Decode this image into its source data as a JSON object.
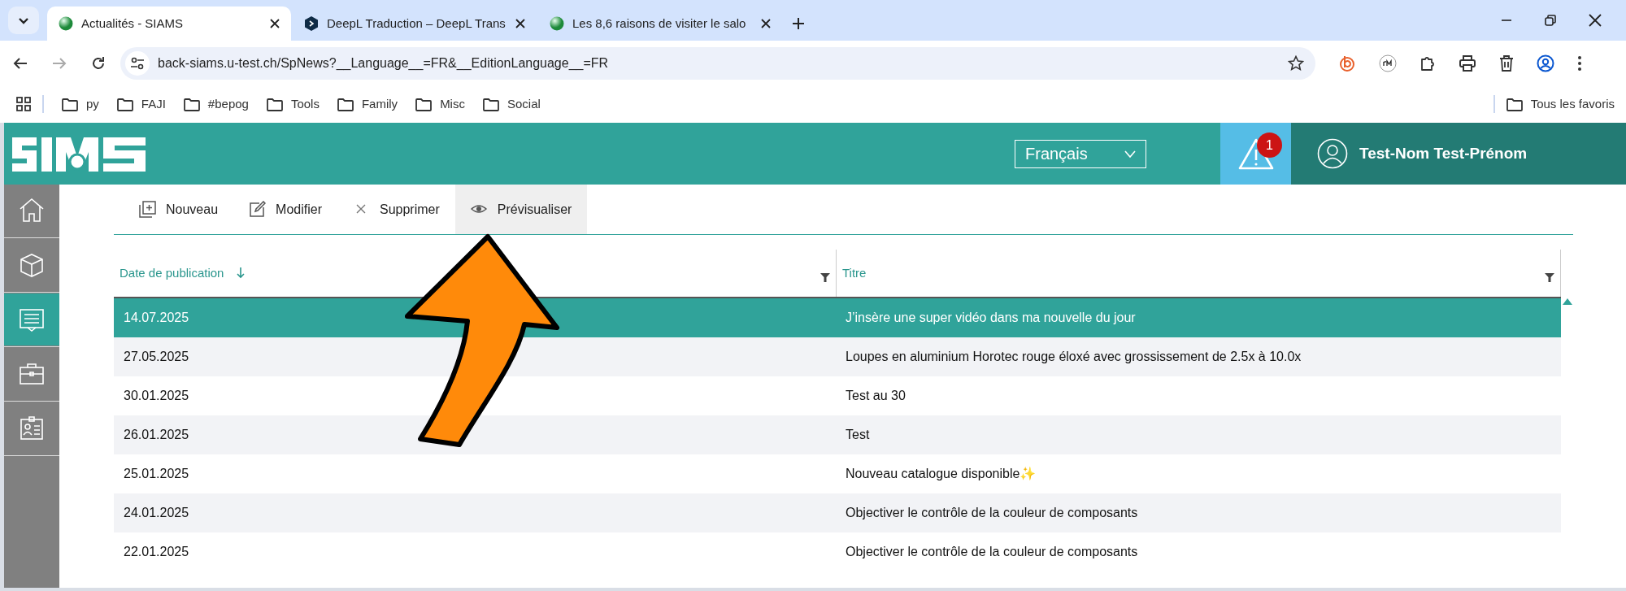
{
  "browser": {
    "tabs": [
      {
        "title": "Actualités - SIAMS",
        "kind": "globe",
        "selected": true
      },
      {
        "title": "DeepL Traduction – DeepL Trans",
        "kind": "deepl",
        "selected": false
      },
      {
        "title": "Les 8,6 raisons de visiter le salo",
        "kind": "globe",
        "selected": false
      }
    ],
    "url": "back-siams.u-test.ch/SpNews?__Language__=FR&__EditionLanguage__=FR",
    "bookmarks": [
      "py",
      "FAJI",
      "#bepog",
      "Tools",
      "Family",
      "Misc",
      "Social"
    ],
    "all_bookmarks": "Tous les favoris"
  },
  "header": {
    "language": "Français",
    "alert_count": "1",
    "user": "Test-Nom Test-Prénom"
  },
  "sidebar": {
    "items": [
      {
        "kind": "home",
        "selected": false
      },
      {
        "kind": "box",
        "selected": false
      },
      {
        "kind": "news",
        "selected": true
      },
      {
        "kind": "briefcase",
        "selected": false
      },
      {
        "kind": "badge",
        "selected": false
      }
    ]
  },
  "toolbar": [
    {
      "label": "Nouveau",
      "kind": "new",
      "highlighted": false
    },
    {
      "label": "Modifier",
      "kind": "edit",
      "highlighted": false
    },
    {
      "label": "Supprimer",
      "kind": "delete",
      "highlighted": false
    },
    {
      "label": "Prévisualiser",
      "kind": "preview",
      "highlighted": true
    }
  ],
  "table": {
    "columns": [
      {
        "label": "Date de publication",
        "sorted": true
      },
      {
        "label": "Titre",
        "sorted": false
      }
    ],
    "rows": [
      {
        "date": "14.07.2025",
        "title": "J’insère une super vidéo dans ma nouvelle du jour",
        "selected": true
      },
      {
        "date": "27.05.2025",
        "title": "Loupes en aluminium Horotec rouge éloxé avec grossissement de 2.5x à 10.0x",
        "selected": false
      },
      {
        "date": "30.01.2025",
        "title": "Test au 30",
        "selected": false
      },
      {
        "date": "26.01.2025",
        "title": "Test",
        "selected": false
      },
      {
        "date": "25.01.2025",
        "title": "Nouveau catalogue disponible✨",
        "selected": false
      },
      {
        "date": "24.01.2025",
        "title": "Objectiver le contrôle de la couleur de composants",
        "selected": false
      },
      {
        "date": "22.01.2025",
        "title": "Objectiver le contrôle de la couleur de composants",
        "selected": false
      }
    ]
  }
}
